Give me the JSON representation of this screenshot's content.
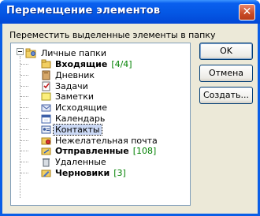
{
  "window": {
    "title": "Перемещение элементов",
    "close_glyph": "✕"
  },
  "prompt": "Переместить выделенные элементы в папку",
  "tree": {
    "root": {
      "label": "Личные папки",
      "icon": "personal-folders-icon"
    },
    "items": [
      {
        "label": "Входящие",
        "count": "[4/4]",
        "bold": true,
        "icon": "inbox-folder-icon"
      },
      {
        "label": "Дневник",
        "count": "",
        "bold": false,
        "icon": "journal-icon"
      },
      {
        "label": "Задачи",
        "count": "",
        "bold": false,
        "icon": "tasks-icon"
      },
      {
        "label": "Заметки",
        "count": "",
        "bold": false,
        "icon": "notes-icon"
      },
      {
        "label": "Исходящие",
        "count": "",
        "bold": false,
        "icon": "outbox-icon"
      },
      {
        "label": "Календарь",
        "count": "",
        "bold": false,
        "icon": "calendar-icon"
      },
      {
        "label": "Контакты",
        "count": "",
        "bold": false,
        "icon": "contacts-icon",
        "selected": true
      },
      {
        "label": "Нежелательная почта",
        "count": "",
        "bold": false,
        "icon": "junk-mail-icon"
      },
      {
        "label": "Отправленные",
        "count": "[108]",
        "bold": true,
        "icon": "sent-items-icon"
      },
      {
        "label": "Удаленные",
        "count": "",
        "bold": false,
        "icon": "deleted-items-icon"
      },
      {
        "label": "Черновики",
        "count": "[3]",
        "bold": true,
        "icon": "drafts-icon"
      }
    ]
  },
  "buttons": {
    "ok": "OK",
    "cancel": "Отмена",
    "create": "Создать..."
  },
  "colors": {
    "title_bar": "#0247d6",
    "dialog_bg": "#ece9d8",
    "count_green": "#008000",
    "selection": "#cbd9f5"
  }
}
